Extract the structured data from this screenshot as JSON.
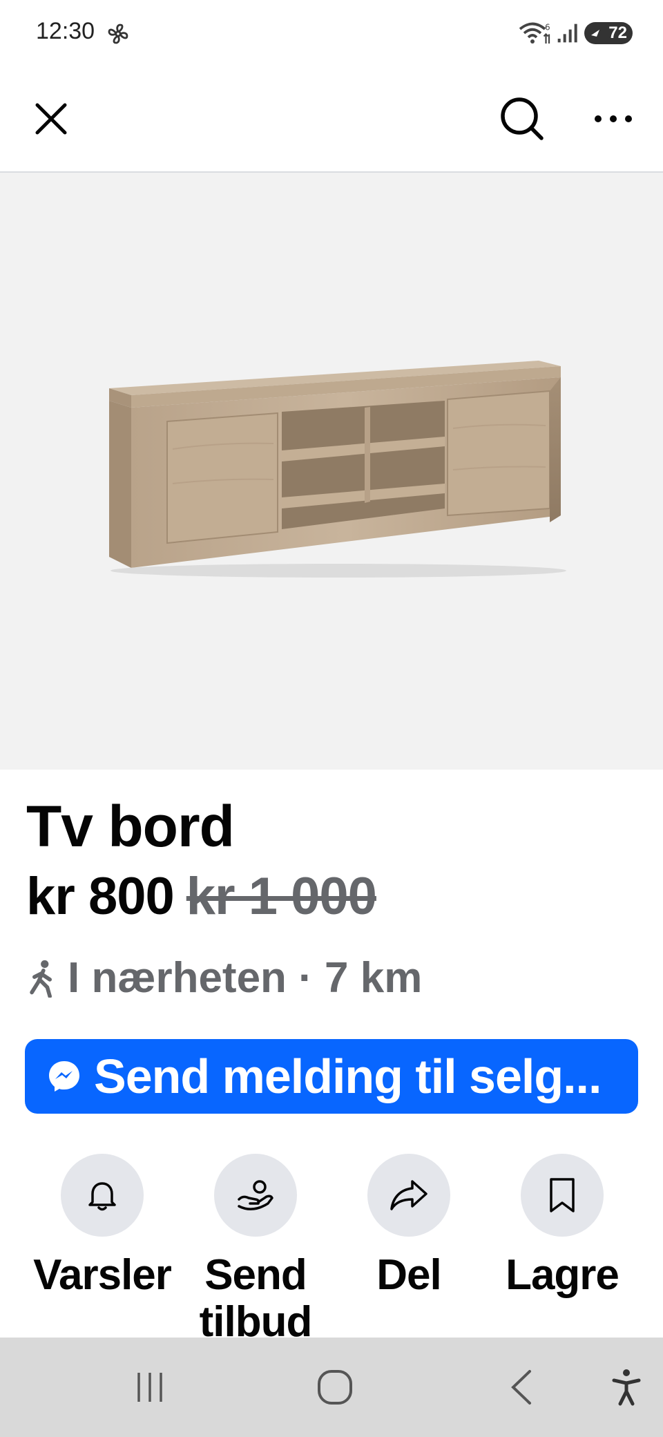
{
  "status_bar": {
    "time": "12:30",
    "battery": "72"
  },
  "header": {
    "close_icon": "close-icon",
    "search_icon": "search-icon",
    "more_icon": "more-horizontal-icon"
  },
  "listing": {
    "title": "Tv bord",
    "price": "kr 800",
    "original_price": "kr 1 000",
    "location": "I nærheten · 7 km",
    "message_button": "Send melding til selg..."
  },
  "actions": [
    {
      "label": "Varsler",
      "icon": "bell-icon"
    },
    {
      "label": "Send tilbud",
      "icon": "offer-hand-icon"
    },
    {
      "label": "Del",
      "icon": "share-icon"
    },
    {
      "label": "Lagre",
      "icon": "bookmark-icon"
    }
  ],
  "colors": {
    "primary": "#0866ff",
    "secondary_text": "#65676b",
    "circle_bg": "#e4e6eb"
  }
}
